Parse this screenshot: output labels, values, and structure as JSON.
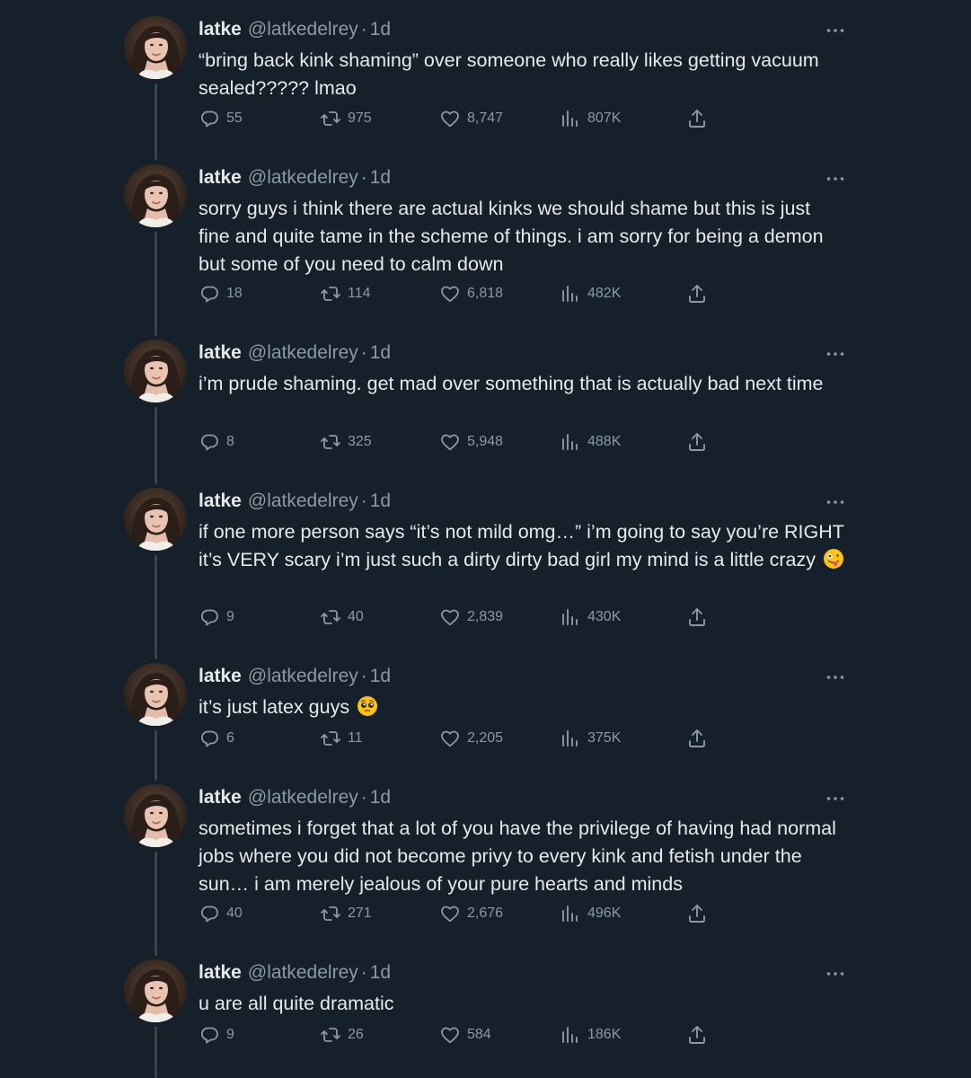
{
  "tweets": [
    {
      "name": "latke",
      "handle": "@latkedelrey",
      "dot": "·",
      "time": "1d",
      "text": "“bring back kink shaming” over someone who really likes getting vacuum sealed????? lmao",
      "replies": "55",
      "retweets": "975",
      "likes": "8,747",
      "views": "807K"
    },
    {
      "name": "latke",
      "handle": "@latkedelrey",
      "dot": "·",
      "time": "1d",
      "text": "sorry guys i think there are actual kinks we should shame but this is just fine and quite tame in the scheme of things. i am sorry for being a demon but some of you need to calm down",
      "replies": "18",
      "retweets": "114",
      "likes": "6,818",
      "views": "482K"
    },
    {
      "name": "latke",
      "handle": "@latkedelrey",
      "dot": "·",
      "time": "1d",
      "text": "i’m prude shaming. get mad over something that is actually bad next time",
      "replies": "8",
      "retweets": "325",
      "likes": "5,948",
      "views": "488K"
    },
    {
      "name": "latke",
      "handle": "@latkedelrey",
      "dot": "·",
      "time": "1d",
      "text": "if one more person says “it’s not mild omg…” i’m going to say you’re RIGHT it’s VERY scary i’m just such a dirty dirty bad girl my mind is a little crazy",
      "emoji": "zany-face-emoji",
      "replies": "9",
      "retweets": "40",
      "likes": "2,839",
      "views": "430K"
    },
    {
      "name": "latke",
      "handle": "@latkedelrey",
      "dot": "·",
      "time": "1d",
      "text": "it’s just latex guys",
      "emoji": "pleading-face-emoji",
      "replies": "6",
      "retweets": "11",
      "likes": "2,205",
      "views": "375K"
    },
    {
      "name": "latke",
      "handle": "@latkedelrey",
      "dot": "·",
      "time": "1d",
      "text": "sometimes i forget that a lot of you have the privilege of having had normal jobs where you did not become privy to every kink and fetish under the sun… i am merely jealous of your pure hearts and minds",
      "replies": "40",
      "retweets": "271",
      "likes": "2,676",
      "views": "496K"
    },
    {
      "name": "latke",
      "handle": "@latkedelrey",
      "dot": "·",
      "time": "1d",
      "text": "u are all quite dramatic",
      "replies": "9",
      "retweets": "26",
      "likes": "584",
      "views": "186K"
    }
  ],
  "icons": {
    "reply": "reply-icon",
    "retweet": "retweet-icon",
    "like": "heart-icon",
    "views": "views-icon",
    "share": "share-icon",
    "more": "more-icon"
  },
  "colors": {
    "background": "#15202b",
    "text": "#e7e9ea",
    "secondary": "#8b98a5",
    "thread_line": "#38444d"
  }
}
